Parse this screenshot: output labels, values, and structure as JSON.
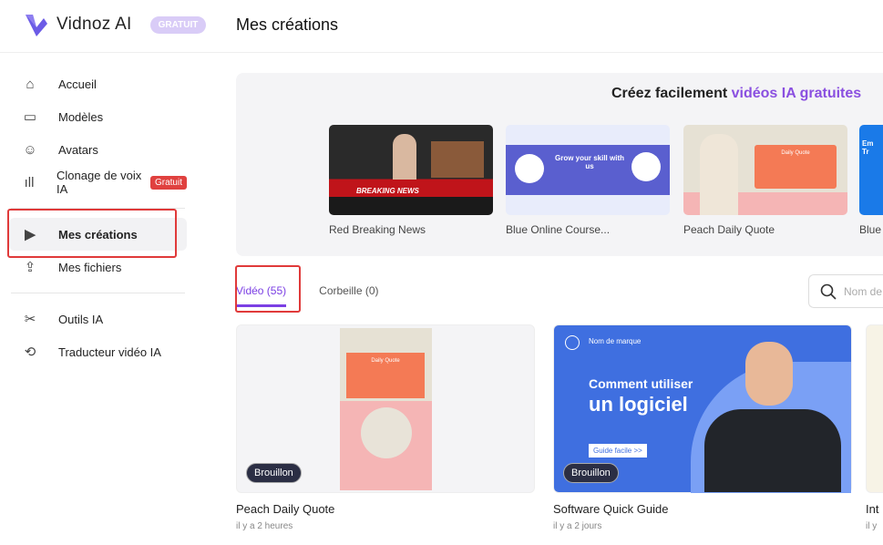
{
  "brand": {
    "name": "Vidnoz AI",
    "badge": "GRATUIT"
  },
  "header": {
    "title": "Mes créations"
  },
  "sidebar": {
    "items": [
      {
        "label": "Accueil",
        "icon": "home-icon"
      },
      {
        "label": "Modèles",
        "icon": "template-icon"
      },
      {
        "label": "Avatars",
        "icon": "avatar-icon"
      },
      {
        "label": "Clonage de voix IA",
        "icon": "voice-icon",
        "tag": "Gratuit"
      },
      {
        "label": "Mes créations",
        "icon": "play-icon",
        "active": true
      },
      {
        "label": "Mes fichiers",
        "icon": "upload-icon"
      },
      {
        "label": "Outils IA",
        "icon": "tools-icon"
      },
      {
        "label": "Traducteur vidéo IA",
        "icon": "translate-icon"
      }
    ]
  },
  "banner": {
    "title_prefix": "Créez facilement ",
    "title_highlight": "vidéos IA gratuites",
    "templates": [
      {
        "name": "Red Breaking News",
        "thumb_text": "BREAKING NEWS"
      },
      {
        "name": "Blue Online Course...",
        "thumb_text": "Grow your skill with us"
      },
      {
        "name": "Peach Daily Quote",
        "thumb_text": "Daily Quote"
      },
      {
        "name": "Blue",
        "thumb_text": "Em Tr"
      }
    ]
  },
  "tabs": [
    {
      "label": "Vidéo (55)",
      "active": true
    },
    {
      "label": "Corbeille (0)"
    }
  ],
  "search": {
    "placeholder": "Nom de"
  },
  "videos": [
    {
      "title": "Peach Daily Quote",
      "time": "il y a 2 heures",
      "status": "Brouillon",
      "thumb_text": "Daily Quote"
    },
    {
      "title": "Software Quick Guide",
      "time": "il y a 2 jours",
      "status": "Brouillon",
      "thumb_brand": "Nom de marque",
      "thumb_line1": "Comment utiliser",
      "thumb_line2": "un logiciel",
      "thumb_button": "Guide facile >>"
    },
    {
      "title": "Int",
      "time": "il y"
    }
  ],
  "colors": {
    "accent": "#7b3fe4",
    "highlight": "#e03a3a"
  }
}
